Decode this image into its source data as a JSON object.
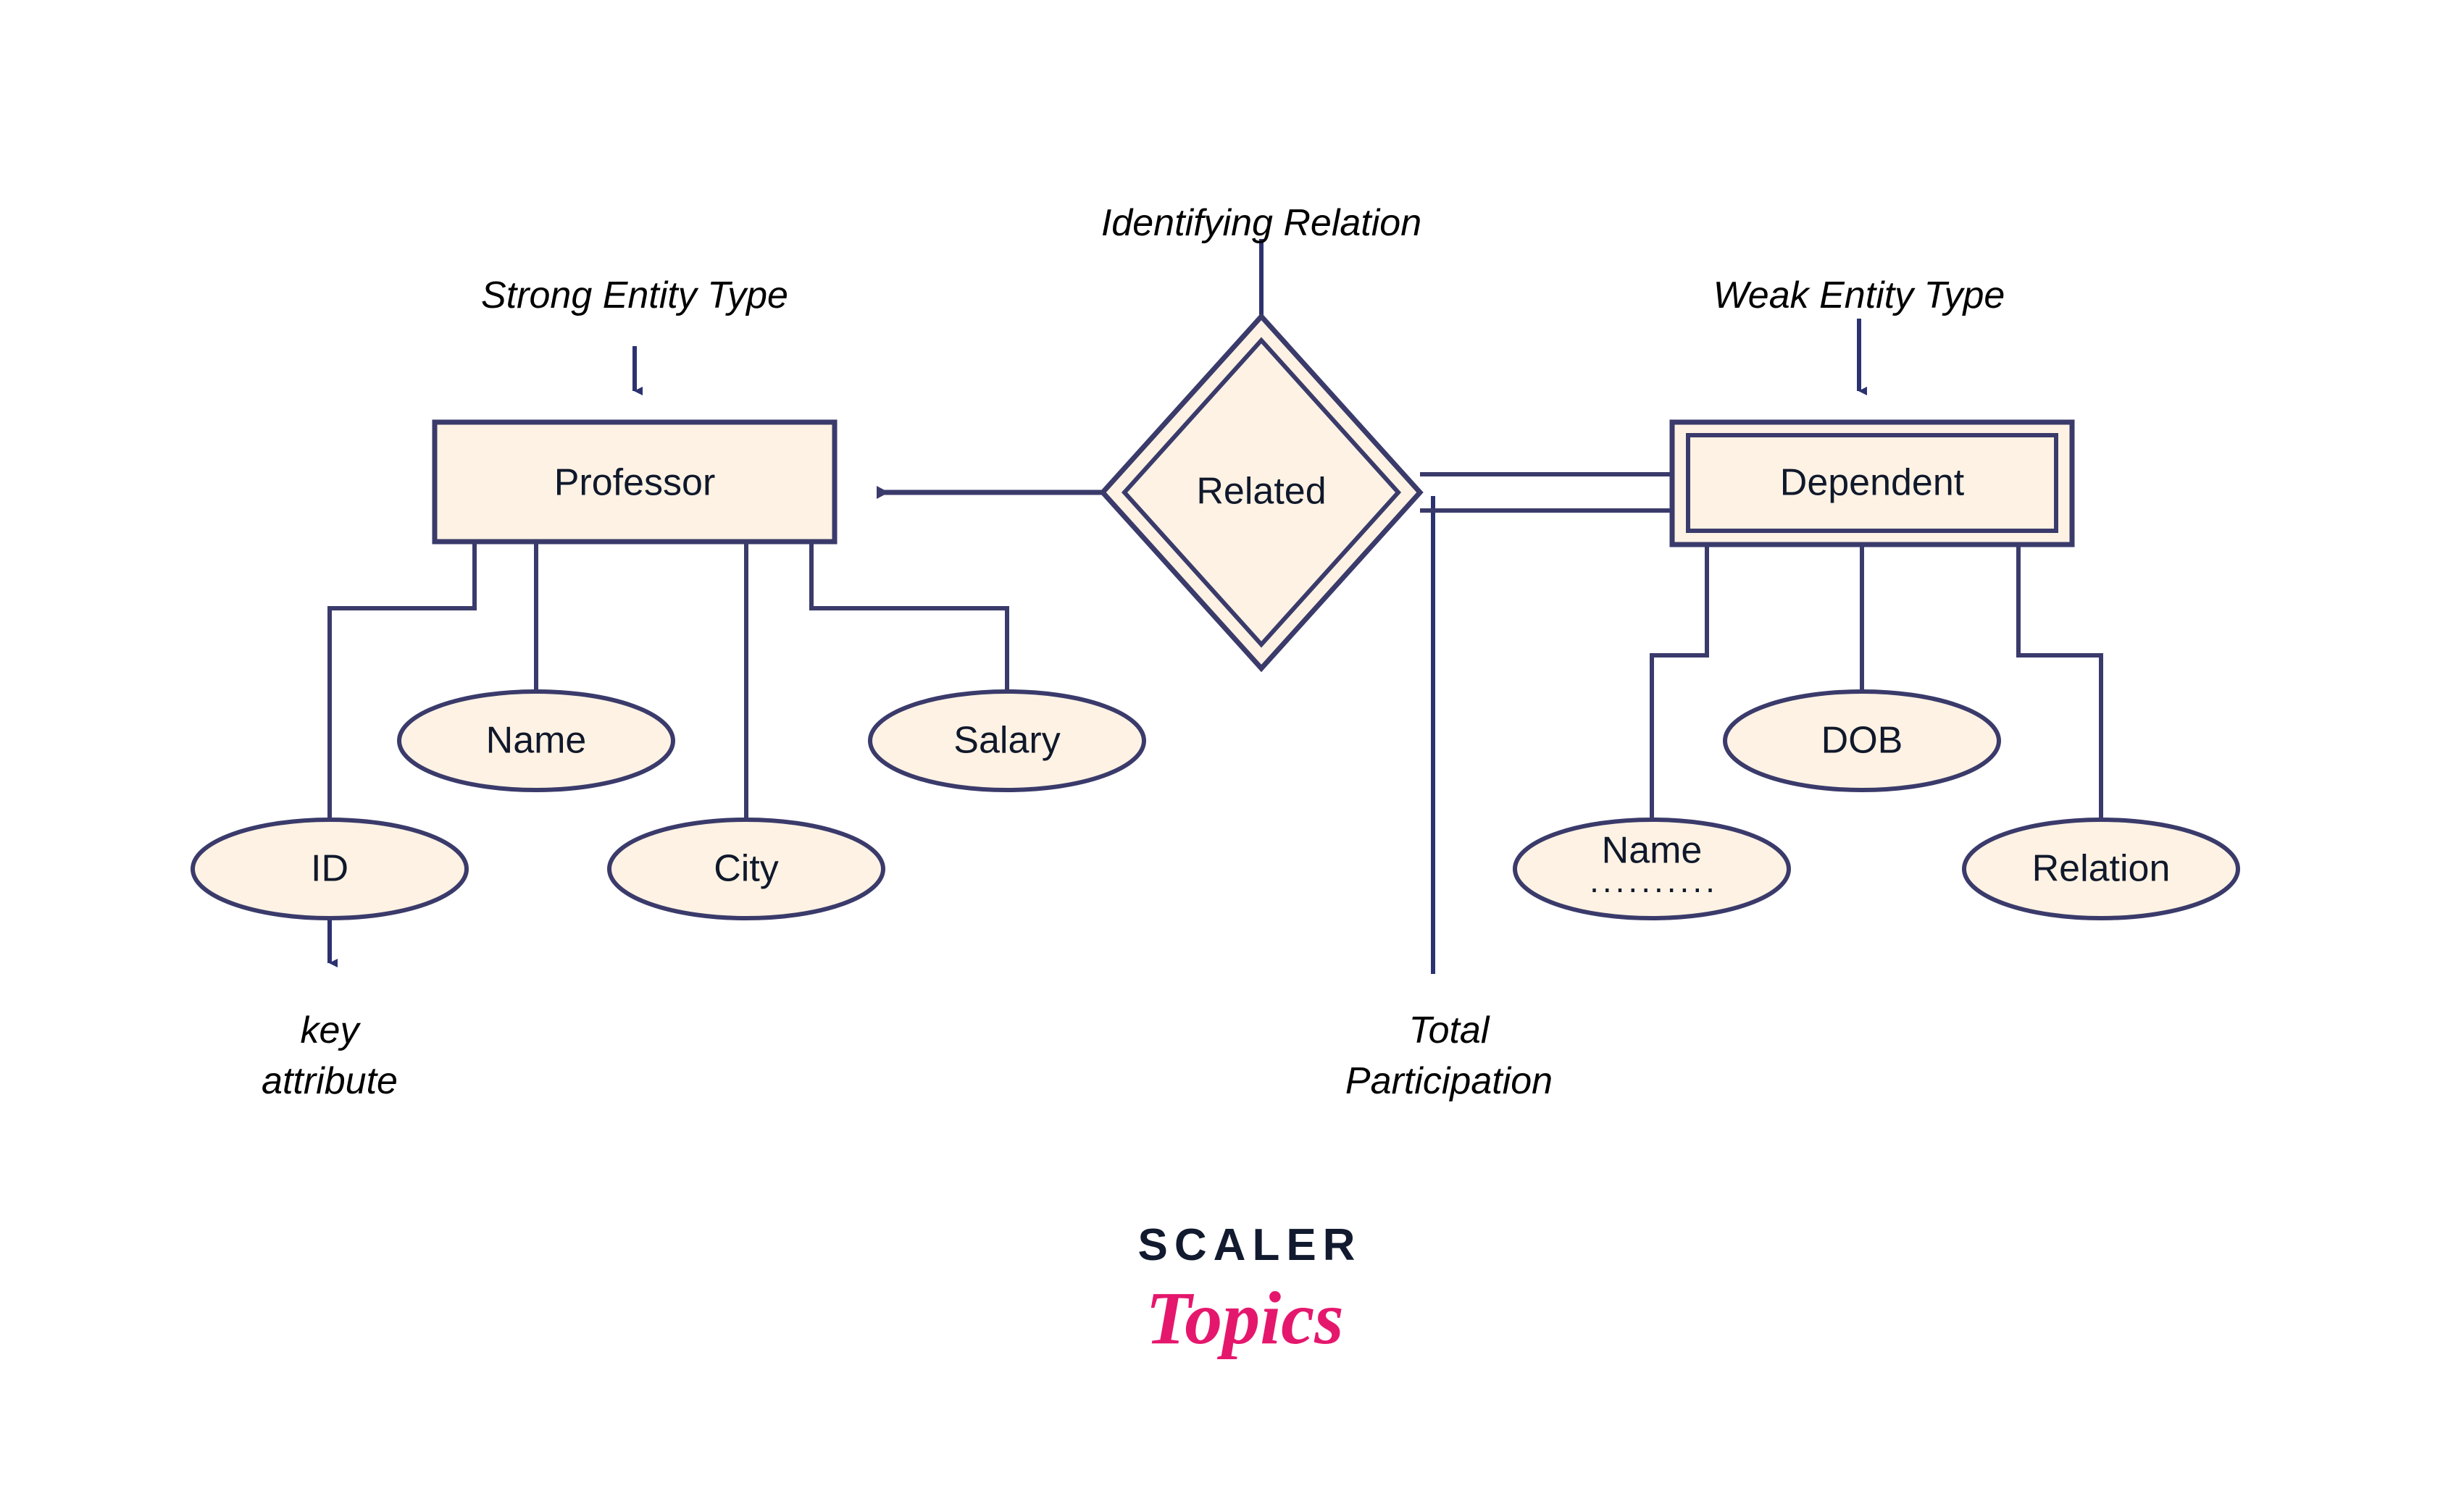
{
  "page": {
    "background": "#ffffff",
    "title": "ER Diagram - Strong and Weak Entity Types"
  },
  "colors": {
    "stroke": "#3a3a6b",
    "fill": "#fdf2e3",
    "text": "#10182b",
    "annotation": "#000000",
    "logo_dark": "#111a2e",
    "logo_pink": "#e5176d"
  },
  "annotations": {
    "strong_entity": "Strong Entity Type",
    "identifying_relation": "Identifying Relation",
    "weak_entity": "Weak Entity Type",
    "key_attribute_line1": "key",
    "key_attribute_line2": "attribute",
    "total_participation_line1": "Total",
    "total_participation_line2": "Participation"
  },
  "entities": {
    "strong": {
      "name": "Professor",
      "shape": "rectangle",
      "attributes": [
        {
          "name": "ID",
          "shape": "ellipse",
          "key": true
        },
        {
          "name": "Name",
          "shape": "ellipse",
          "key": false
        },
        {
          "name": "City",
          "shape": "ellipse",
          "key": false
        },
        {
          "name": "Salary",
          "shape": "ellipse",
          "key": false
        }
      ]
    },
    "weak": {
      "name": "Dependent",
      "shape": "double-rectangle",
      "attributes": [
        {
          "name": "Name",
          "shape": "ellipse",
          "partial_key": true,
          "partial_key_marker": ".........."
        },
        {
          "name": "DOB",
          "shape": "ellipse",
          "partial_key": false
        },
        {
          "name": "Relation",
          "shape": "ellipse",
          "partial_key": false
        }
      ]
    }
  },
  "relationship": {
    "name": "Related",
    "shape": "double-diamond",
    "from": "Related",
    "to_strong": "Professor",
    "to_weak": "Dependent",
    "strong_side_connector": "single-line-with-arrow",
    "weak_side_connector": "double-line"
  },
  "logo": {
    "brand": "SCALER",
    "product": "Topics"
  }
}
